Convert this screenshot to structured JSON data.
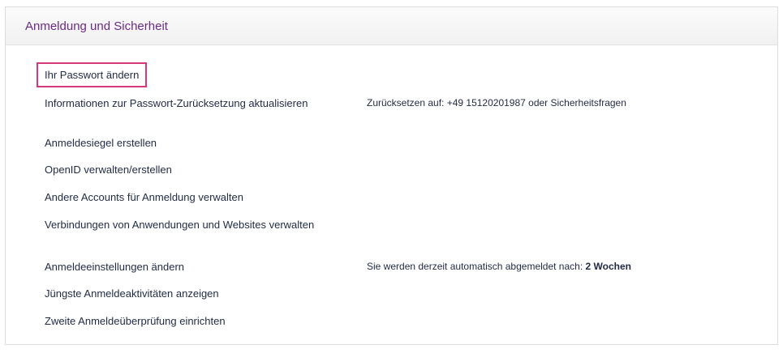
{
  "section": {
    "title": "Anmeldung und Sicherheit"
  },
  "items": [
    {
      "label": "Ihr Passwort ändern"
    },
    {
      "label": "Informationen zur Passwort-Zurücksetzung aktualisieren"
    },
    {
      "label": "Anmeldesiegel erstellen"
    },
    {
      "label": "OpenID verwalten/erstellen"
    },
    {
      "label": "Andere Accounts für Anmeldung verwalten"
    },
    {
      "label": "Verbindungen von Anwendungen und Websites verwalten"
    },
    {
      "label": "Anmeldeeinstellungen ändern"
    },
    {
      "label": "Jüngste Anmeldeaktivitäten anzeigen"
    },
    {
      "label": "Zweite Anmeldeüberprüfung einrichten"
    }
  ],
  "info": {
    "reset_text": "Zurücksetzen auf: +49 15120201987 oder Sicherheitsfragen",
    "logout_prefix": "Sie werden derzeit automatisch abgemeldet nach:",
    "logout_value": "2 Wochen"
  },
  "colors": {
    "title": "#6b2a86",
    "highlight_border": "#d7377b"
  }
}
